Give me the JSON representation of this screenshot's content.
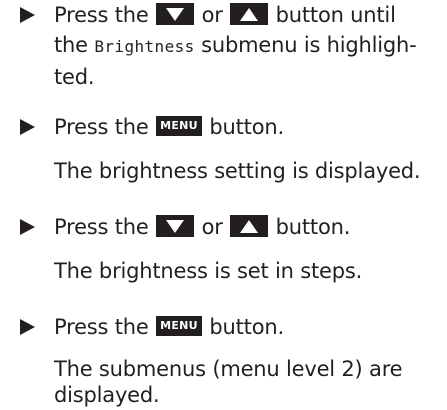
{
  "steps": [
    {
      "press": "Press the",
      "or": "or",
      "suffix": "button until",
      "line2_pre": "the",
      "submenu_name": "Brightness",
      "line2_post": "submenu is highligh-",
      "line3": "ted."
    },
    {
      "press": "Press the",
      "key": "MENU",
      "suffix": "button.",
      "result": "The brightness setting is displayed."
    },
    {
      "press": "Press the",
      "or": "or",
      "suffix": "button.",
      "result": "The brightness is set in steps."
    },
    {
      "press": "Press the",
      "key": "MENU",
      "suffix": "button.",
      "result_line1": "The submenus (menu level 2) are",
      "result_line2": "displayed."
    }
  ],
  "icons": {
    "bullet": "triangle-right-icon",
    "down_key": "down-arrow-button-icon",
    "up_key": "up-arrow-button-icon"
  },
  "colors": {
    "text": "#231f20",
    "key_background": "#231f20",
    "key_foreground": "#ffffff"
  }
}
